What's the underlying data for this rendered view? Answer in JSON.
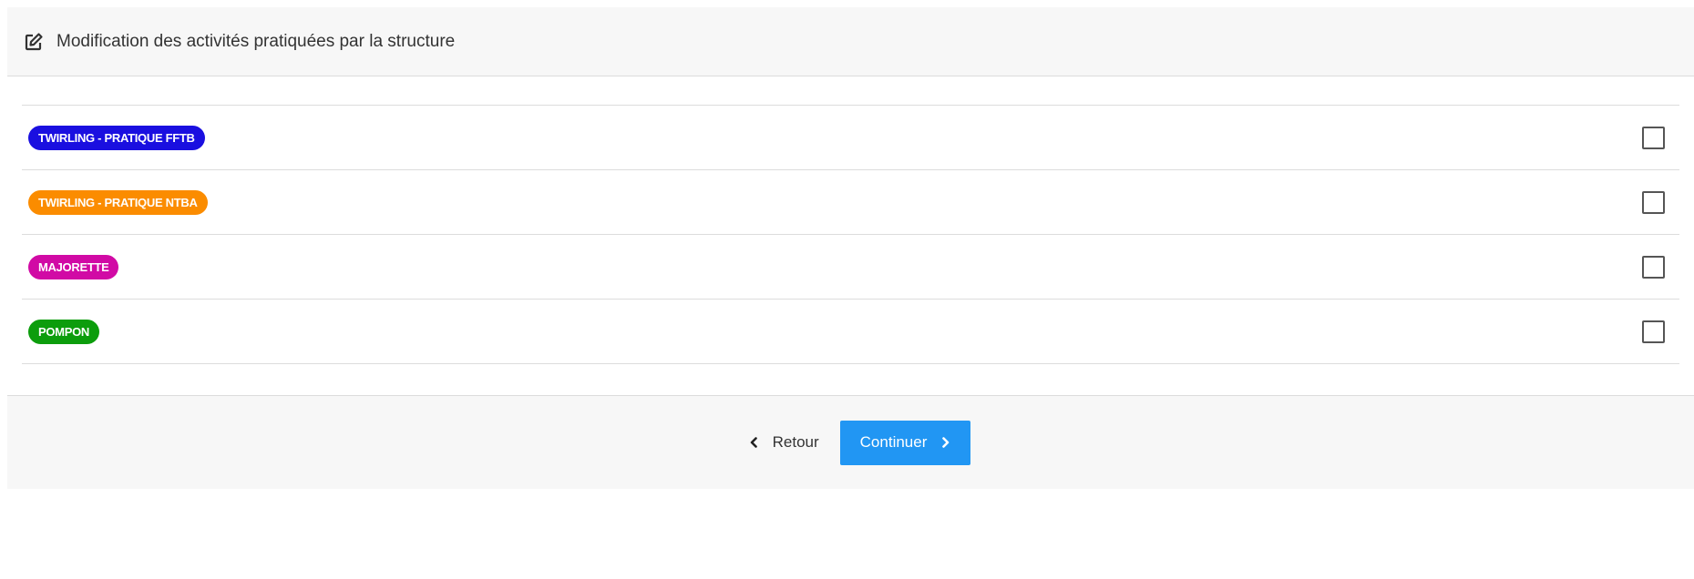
{
  "header": {
    "icon": "edit-icon",
    "title": "Modification des activités pratiquées par la structure"
  },
  "activities": [
    {
      "label": "TWIRLING - PRATIQUE FFTB",
      "color": "#1a0fe0",
      "checked": false
    },
    {
      "label": "TWIRLING - PRATIQUE NTBA",
      "color": "#fb8c00",
      "checked": false
    },
    {
      "label": "MAJORETTE",
      "color": "#d10aa5",
      "checked": false
    },
    {
      "label": "POMPON",
      "color": "#0c9d0c",
      "checked": false
    }
  ],
  "footer": {
    "back_label": "Retour",
    "continue_label": "Continuer",
    "continue_color": "#2196f3"
  }
}
